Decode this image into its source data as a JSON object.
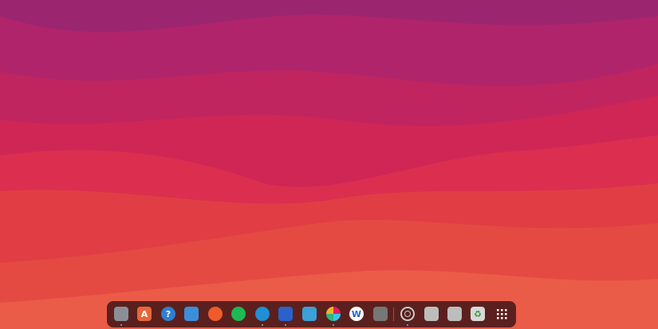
{
  "desktop": {
    "wallpaper_colors": [
      "#9c2570",
      "#b8246a",
      "#c8245e",
      "#d62a52",
      "#e03c46",
      "#e64a42",
      "#ea5e48"
    ]
  },
  "dock": {
    "items": [
      {
        "name": "files",
        "icon": "folder-icon",
        "running": true,
        "color": "#8a8f96"
      },
      {
        "name": "app-center",
        "icon": "store-bag-icon",
        "running": false,
        "color": "#e8663a",
        "glyph": "A"
      },
      {
        "name": "help",
        "icon": "help-icon",
        "running": false,
        "color": "#2f7fd0",
        "glyph": "?"
      },
      {
        "name": "system-monitor",
        "icon": "monitor-graph-icon",
        "running": false,
        "color": "#3b8fd8"
      },
      {
        "name": "postman",
        "icon": "postman-icon",
        "running": false,
        "color": "#ef5b2b"
      },
      {
        "name": "spotify",
        "icon": "spotify-icon",
        "running": false,
        "color": "#1db954"
      },
      {
        "name": "edge",
        "icon": "edge-browser-icon",
        "running": true,
        "color": "#1f8fd6"
      },
      {
        "name": "mail",
        "icon": "mail-icon",
        "running": true,
        "color": "#2a62c9"
      },
      {
        "name": "weather",
        "icon": "cloud-icon",
        "running": false,
        "color": "#3aa0d8"
      },
      {
        "name": "slack",
        "icon": "slack-icon",
        "running": true,
        "color": "#ffffff"
      },
      {
        "name": "app-w",
        "icon": "w-app-icon",
        "running": false,
        "color": "#ffffff"
      },
      {
        "name": "screenshot",
        "icon": "screenshot-icon",
        "running": false,
        "color": "#777777"
      },
      {
        "name": "settings",
        "icon": "gear-icon",
        "running": true,
        "color": "#d0d0d0"
      },
      {
        "name": "document-1",
        "icon": "document-icon",
        "running": false,
        "color": "#bdbdbd"
      },
      {
        "name": "document-2",
        "icon": "document-icon",
        "running": false,
        "color": "#bdbdbd"
      },
      {
        "name": "trash",
        "icon": "trash-icon",
        "running": false,
        "color": "#d8d8d8",
        "glyph": "♻"
      },
      {
        "name": "show-apps",
        "icon": "grid-icon",
        "running": false,
        "color": "#ffffff"
      }
    ]
  }
}
